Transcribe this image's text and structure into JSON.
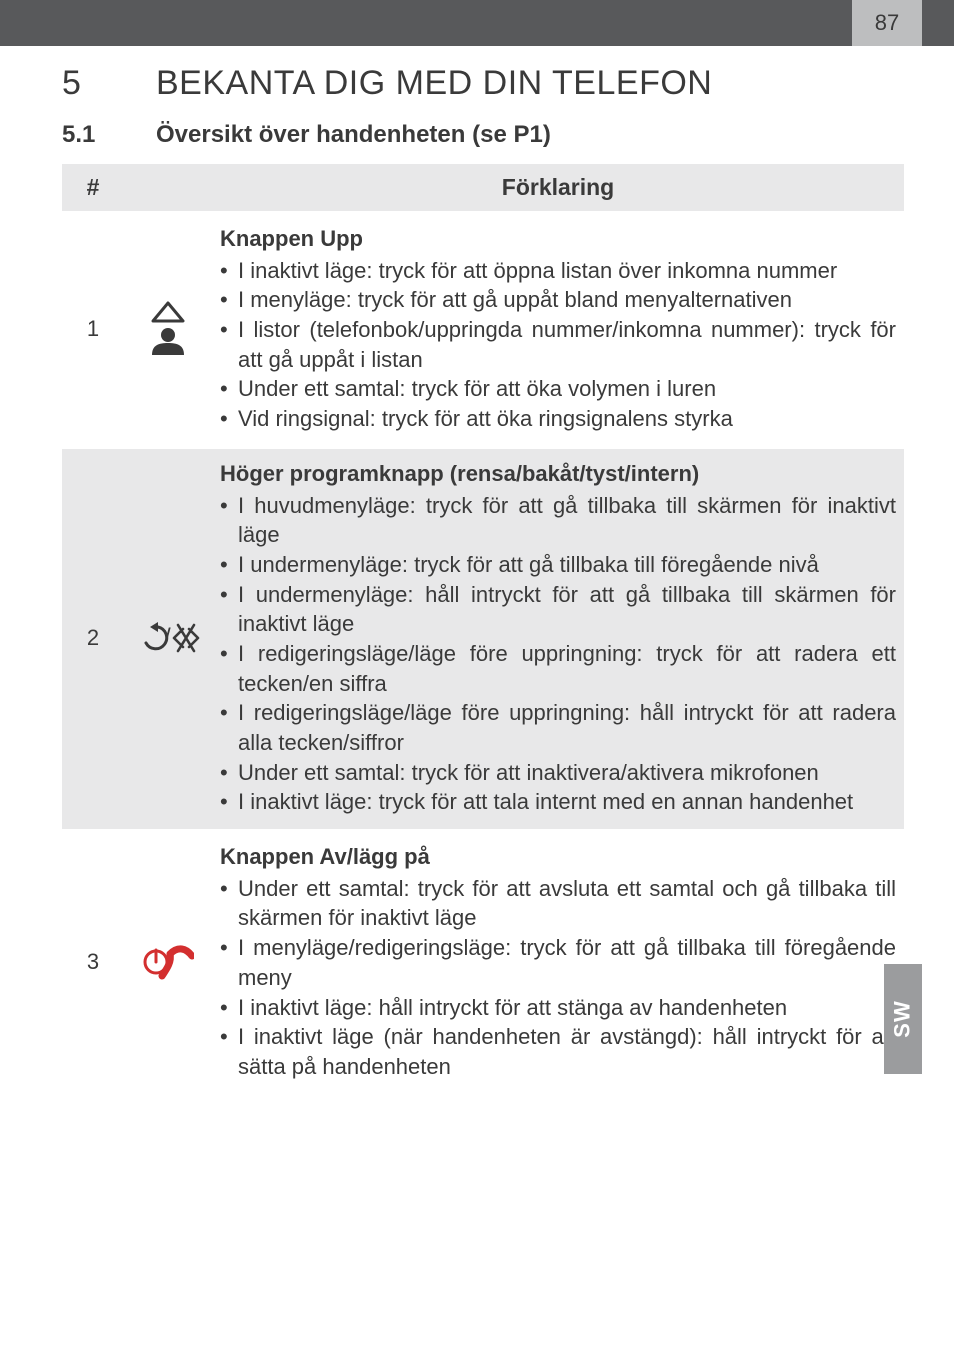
{
  "page_number": "87",
  "side_tab": "SW",
  "heading": {
    "num": "5",
    "text": "BEKANTA DIG MED DIN TELEFON"
  },
  "subheading": {
    "num": "5.1",
    "text": "Översikt över handenheten (se P1)"
  },
  "table": {
    "header_hash": "#",
    "header_expl": "Förklaring",
    "rows": [
      {
        "num": "1",
        "icon": "up-contacts-icon",
        "title": "Knappen Upp",
        "items": [
          "I inaktivt läge: tryck för att öppna listan över inkomna nummer",
          "I menyläge: tryck för att gå uppåt bland menyalternativen",
          "I listor (telefonbok/uppringda nummer/inkomna nummer): tryck för att gå uppåt i listan",
          "Under ett samtal: tryck för att öka volymen i luren",
          "Vid ringsignal: tryck för att öka ringsignalens styrka"
        ]
      },
      {
        "num": "2",
        "icon": "back-mute-icon",
        "title": "Höger programknapp (rensa/bakåt/tyst/intern)",
        "items": [
          "I huvudmenyläge: tryck för att gå tillbaka till skärmen för inaktivt läge",
          "I undermenyläge: tryck för att gå tillbaka till föregående nivå",
          "I undermenyläge: håll intryckt för att gå tillbaka till skärmen för inaktivt läge",
          "I redigeringsläge/läge före uppringning: tryck för att radera ett tecken/en siffra",
          "I redigeringsläge/läge före uppringning: håll intryckt för att radera alla tecken/siffror",
          "Under ett samtal: tryck för att inaktivera/aktivera mikrofonen",
          "I inaktivt läge: tryck för att tala internt med en annan handenhet"
        ]
      },
      {
        "num": "3",
        "icon": "power-hangup-icon",
        "title": "Knappen Av/lägg på",
        "items": [
          "Under ett samtal: tryck för att avsluta ett samtal och gå tillbaka till skärmen för inaktivt läge",
          "I menyläge/redigeringsläge: tryck för att gå tillbaka till föregående meny",
          "I inaktivt läge: håll intryckt för att stänga av handenheten",
          "I inaktivt läge (när handenheten är avstängd): håll intryckt för att sätta på handenheten"
        ]
      }
    ]
  }
}
